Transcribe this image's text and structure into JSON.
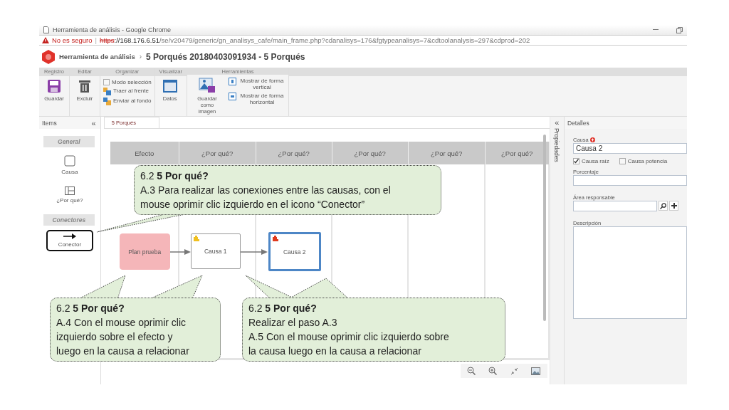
{
  "window": {
    "title": "Herramienta de análisis - Google Chrome"
  },
  "address_bar": {
    "security": "No es seguro",
    "separator": "|",
    "url_scheme": "https",
    "url_host": "://168.176.6.51",
    "url_path": "/se/v20479/generic/gn_analisys_cafe/main_frame.php?cdanalisys=176&fgtypeanalisys=7&cdtoolanalysis=297&cdprod=202"
  },
  "breadcrumb": {
    "parent": "Herramienta de análisis",
    "separator": "›",
    "current": "5 Porqués 20180403091934 - 5 Porqués"
  },
  "ribbon": [
    {
      "group": "Registro",
      "items": [
        {
          "kind": "big",
          "label": "Guardar"
        }
      ]
    },
    {
      "group": "Editar",
      "items": [
        {
          "kind": "big",
          "label": "Excluir"
        }
      ]
    },
    {
      "group": "Organizar",
      "items": [
        {
          "kind": "check",
          "label": "Modo selección",
          "checked": false
        },
        {
          "kind": "small",
          "label": "Traer al frente"
        },
        {
          "kind": "small",
          "label": "Enviar al fondo"
        }
      ]
    },
    {
      "group": "Visualizar",
      "items": [
        {
          "kind": "big",
          "label": "Datos"
        }
      ]
    },
    {
      "group": "Herramientas",
      "items": [
        {
          "kind": "big",
          "label": "Guardar como imagen"
        },
        {
          "kind": "stack",
          "items": [
            {
              "label": "Mostrar de forma vertical"
            },
            {
              "label": "Mostrar de forma horizontal"
            }
          ]
        }
      ]
    }
  ],
  "items_panel": {
    "title": "Items",
    "collapse": "«",
    "sections": [
      {
        "title": "General",
        "items": [
          {
            "label": "Causa",
            "selected": false
          },
          {
            "label": "¿Por qué?",
            "selected": false
          }
        ]
      },
      {
        "title": "Conectores",
        "items": [
          {
            "label": "Conector",
            "selected": true
          }
        ]
      }
    ]
  },
  "canvas": {
    "tab": "5 Porqués",
    "columns": [
      "Efecto",
      "¿Por qué?",
      "¿Por qué?",
      "¿Por qué?",
      "¿Por qué?",
      "¿Por qué?"
    ],
    "nodes": [
      {
        "kind": "effect",
        "label": "Plan prueba",
        "selected": false
      },
      {
        "kind": "cause",
        "label": "Causa 1",
        "selected": false,
        "color": "#f0c020"
      },
      {
        "kind": "cause",
        "label": "Causa 2",
        "selected": true,
        "color": "#e03a1e"
      }
    ]
  },
  "properties_strip": {
    "collapse": "«",
    "label": "Propiedades"
  },
  "details": {
    "title": "Detalles",
    "cause_label": "Causa",
    "cause_value": "Causa 2",
    "checks": [
      {
        "label": "Causa raíz",
        "checked": true
      },
      {
        "label": "Causa potencia",
        "checked": false
      }
    ],
    "percent_label": "Porcentaje",
    "area_label": "Área responsable",
    "description_label": "Descripción"
  },
  "callouts": [
    {
      "heading": "6.2 **5 Por qué?**",
      "lines": [
        "A.3 Para realizar las conexiones entre las causas, con el",
        "mouse oprimir clic izquierdo en el icono “Conector”"
      ]
    },
    {
      "heading": "6.2 **5 Por qué?**",
      "lines": [
        "A.4 Con el mouse oprimir clic",
        "izquierdo sobre el efecto y",
        "luego en la causa a relacionar"
      ]
    },
    {
      "heading": "6.2 **5 Por qué?**",
      "lines": [
        "Realizar el paso A.3",
        "A.5 Con el mouse oprimir clic izquierdo sobre",
        "la causa luego en la causa a relacionar"
      ]
    }
  ]
}
